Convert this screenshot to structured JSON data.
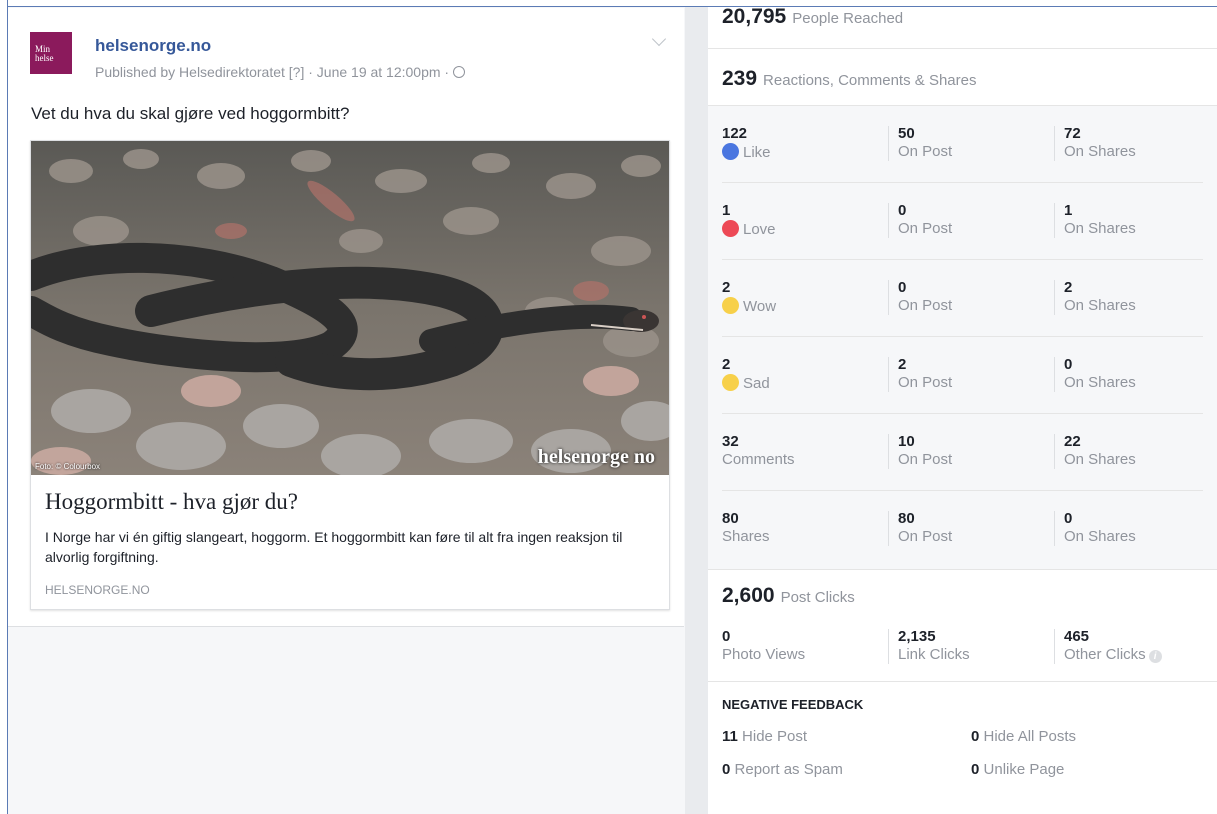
{
  "post": {
    "avatar_text_line1": "Min",
    "avatar_text_line2": "helse",
    "page_name": "helsenorge.no",
    "publisher_line": "Published by Helsedirektoratet [?] · June 19 at 12:00pm ·",
    "message": "Vet du hva du skal gjøre ved hoggormbitt?",
    "image_watermark": "helsenorge no",
    "image_credit": "Foto: © Colourbox",
    "card_title": "Hoggormbitt - hva gjør du?",
    "card_description": "I Norge har vi én giftig slangeart, hoggorm. Et hoggormbitt kan føre til alt fra ingen reaksjon til alvorlig forgiftning.",
    "card_domain": "HELSENORGE.NO"
  },
  "insights": {
    "reach": {
      "value": "20,795",
      "label": "People Reached"
    },
    "engagement": {
      "value": "239",
      "label": "Reactions, Comments & Shares"
    },
    "rows": [
      {
        "total": "122",
        "label": "Like",
        "icon": "like-icon",
        "on_post": "50",
        "on_shares": "72"
      },
      {
        "total": "1",
        "label": "Love",
        "icon": "love-icon",
        "on_post": "0",
        "on_shares": "1"
      },
      {
        "total": "2",
        "label": "Wow",
        "icon": "wow-icon",
        "on_post": "0",
        "on_shares": "2"
      },
      {
        "total": "2",
        "label": "Sad",
        "icon": "sad-icon",
        "on_post": "2",
        "on_shares": "0"
      },
      {
        "total": "32",
        "label": "Comments",
        "icon": "",
        "on_post": "10",
        "on_shares": "22"
      },
      {
        "total": "80",
        "label": "Shares",
        "icon": "",
        "on_post": "80",
        "on_shares": "0"
      }
    ],
    "on_post_label": "On Post",
    "on_shares_label": "On Shares",
    "post_clicks": {
      "value": "2,600",
      "label": "Post Clicks"
    },
    "clicks": [
      {
        "value": "0",
        "label": "Photo Views"
      },
      {
        "value": "2,135",
        "label": "Link Clicks"
      },
      {
        "value": "465",
        "label": "Other Clicks"
      }
    ],
    "negative": {
      "title": "NEGATIVE FEEDBACK",
      "hide_post": {
        "value": "11",
        "label": "Hide Post"
      },
      "hide_all": {
        "value": "0",
        "label": "Hide All Posts"
      },
      "report_spam": {
        "value": "0",
        "label": "Report as Spam"
      },
      "unlike_page": {
        "value": "0",
        "label": "Unlike Page"
      }
    }
  }
}
